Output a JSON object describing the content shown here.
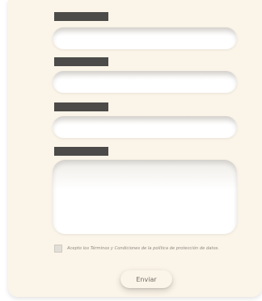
{
  "form": {
    "fields": [
      {
        "type": "input",
        "value": ""
      },
      {
        "type": "input",
        "value": ""
      },
      {
        "type": "input",
        "value": ""
      },
      {
        "type": "textarea",
        "value": ""
      }
    ],
    "consent": {
      "checked": false,
      "label": "Acepto los Términos y Condiciones de la política de protección de datos."
    },
    "submit_label": "Enviar"
  },
  "colors": {
    "card_background": "#fbf4e8",
    "label_bar": "#4c4b49",
    "field_background": "#ffffff",
    "text_muted": "#8c8983"
  }
}
